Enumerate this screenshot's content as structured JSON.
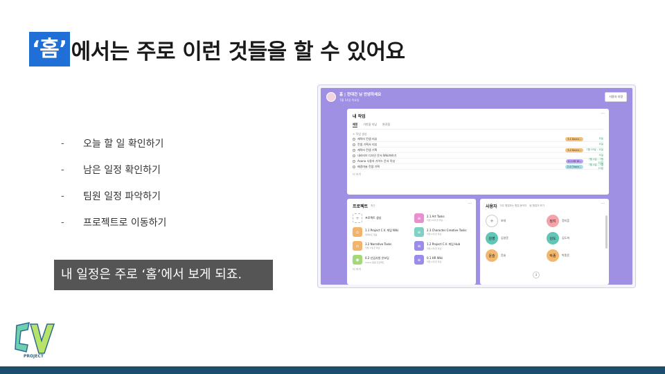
{
  "slide": {
    "title_highlight": "‘홈’",
    "title_rest": "에서는 주로 이런 것들을 할 수 있어요",
    "bullets": [
      "오늘 할 일 확인하기",
      "남은 일정 확인하기",
      "팀원 일정 파악하기",
      "프로젝트로 이동하기"
    ],
    "bullet_marker": "-",
    "callout": "내 일정은 주로 ‘홈’에서 보게 되죠.",
    "logo_text": "PROJECT"
  },
  "colors": {
    "title_highlight": "#1f6fd6",
    "callout_bg": "#555555",
    "bottom_bar": "#1d4e6e",
    "app_bg": "#9f90e4"
  },
  "app": {
    "greeting": "홈 | 전대건 님 안녕하세요",
    "date": "7월 14일 목요일",
    "customize_button": "사용자 지정",
    "my_work": {
      "title": "내 작업",
      "tabs": [
        "예정",
        "기한을 지남",
        "완료됨"
      ],
      "add_task": "+ 작업 생성",
      "tasks": [
        {
          "name": "캐릭터 컨셉 리뷰",
          "tag": "3.1 Narra...",
          "tag_color": "#f3c27a",
          "due": "오늘"
        },
        {
          "name": "컨셉 기획서 리뷰",
          "tag": "",
          "tag_color": "",
          "due": "오늘"
        },
        {
          "name": "캐릭터 컨셉 기획",
          "tag": "3.2 Narra...",
          "tag_color": "#f3c27a",
          "due": "7월 15일 – 오늘"
        },
        {
          "name": "내러티브 디자인 문서 Wiki화하기",
          "tag": "",
          "tag_color": "",
          "due": "오늘"
        },
        {
          "name": "Asana 사용자 가이드 문서 작성",
          "tag": "0.1 HR W...",
          "tag_color": "#b9a4f2",
          "due": "7월 4일 – 7월 15일"
        },
        {
          "name": "배경미술 컨셉 기획",
          "tag": "2.4 Chara...",
          "tag_color": "#a8e0e8",
          "due": "7월 4일 – 7월 15일"
        }
      ],
      "more": "더 보기"
    },
    "projects": {
      "title": "프로젝트",
      "filter": "최근",
      "items": [
        {
          "name": "프로젝트 생성",
          "meta": "",
          "icon": "plus-icon",
          "color": ""
        },
        {
          "name": "2.1 Art Tasks",
          "meta": "작업 14개 곧 마감",
          "icon": "list-icon",
          "color": "#e88fd0"
        },
        {
          "name": "1.1 Project C.V. 게임 Wiki",
          "meta": "업데이트 없음",
          "icon": "home-icon",
          "color": "#f1b46a"
        },
        {
          "name": "2.3 Character Creative Tasks",
          "meta": "작업 2개 곧 마감",
          "icon": "list-icon",
          "color": "#7ed1c4"
        },
        {
          "name": "3.2 Narrative Tasks",
          "meta": "작업 1개 곧 마감",
          "icon": "home-icon",
          "color": "#f1b46a"
        },
        {
          "name": "1.2 Project C.V. 게임 Hub",
          "meta": "작업 2개 곧 마감",
          "icon": "list-icon",
          "color": "#9a8ce8"
        },
        {
          "name": "0.2 신입사원 온보딩",
          "meta": "Asana 팀원 프로젝트",
          "icon": "target-icon",
          "color": "#a4d97a"
        },
        {
          "name": "0.1 HR Wiki",
          "meta": "작업 1개 곧 마감",
          "icon": "list-icon",
          "color": "#9a8ce8"
        }
      ],
      "more": "더 보기"
    },
    "users": {
      "title": "사용자",
      "filter": "자주 협업하는 협업 동작자",
      "people_label": "팀 협업자 보기",
      "invite": "초대",
      "members": [
        {
          "avatar": "",
          "name": "초대",
          "color": ""
        },
        {
          "avatar": "정지",
          "name": "정지훈",
          "color": "#f4a3a8"
        },
        {
          "avatar": "김영",
          "name": "김영준",
          "color": "#5fc6b8"
        },
        {
          "avatar": "김도",
          "name": "김도희",
          "color": "#5fc6b8"
        },
        {
          "avatar": "윤슬",
          "name": "윤슬",
          "color": "#f3b870"
        },
        {
          "avatar": "박종",
          "name": "박종윤",
          "color": "#f3b870"
        }
      ]
    }
  }
}
